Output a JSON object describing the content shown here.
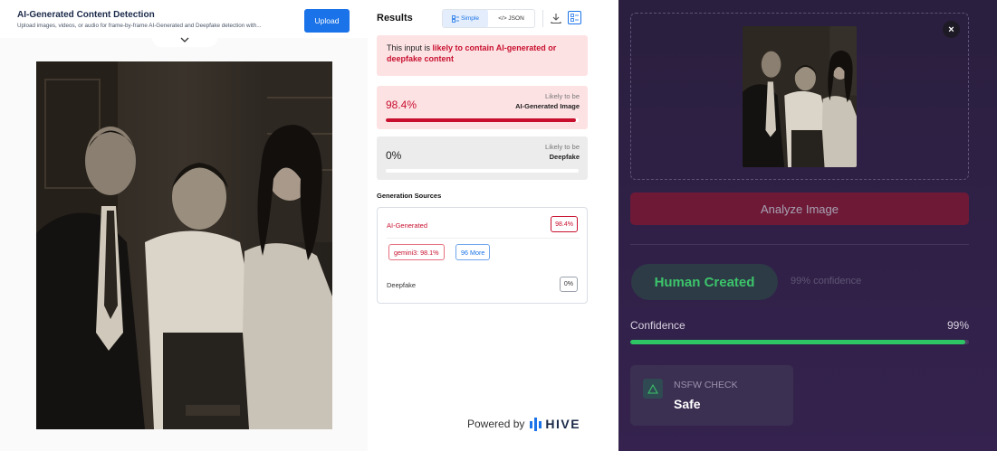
{
  "left_panel": {
    "title": "AI-Generated Content Detection",
    "subtitle": "Upload images, videos, or audio for frame-by-frame AI-Generated and Deepfake detection with...",
    "upload_label": "Upload",
    "collapse_icon": "chevron-down-icon",
    "photo_description_icon": "photo-image"
  },
  "results": {
    "title": "Results",
    "view_toggle": {
      "simple_label": "Simple",
      "json_label": "</> JSON",
      "selected": "Simple"
    },
    "icons": [
      "download-icon",
      "grid-view-icon"
    ],
    "alert": {
      "prefix": "This input is ",
      "highlight": "likely to contain AI-generated or deepfake content"
    },
    "scores": [
      {
        "percent": "98.4%",
        "label_top": "Likely to be",
        "label_bottom": "AI-Generated Image",
        "value": 0.984,
        "color": "#c8102e"
      },
      {
        "percent": "0%",
        "label_top": "Likely to be",
        "label_bottom": "Deepfake",
        "value": 0.0,
        "color": "#c8102e"
      }
    ],
    "generation_sources": {
      "title": "Generation Sources",
      "ai_label": "AI-Generated",
      "ai_value": "98.4%",
      "chips": [
        "gemini3: 98.1%",
        "96 More"
      ],
      "deepfake_label": "Deepfake",
      "deepfake_value": "0%"
    },
    "powered_by": "Powered by",
    "brand": "HIVE"
  },
  "analyzer": {
    "close_icon": "close-icon",
    "analyze_label": "Analyze Image",
    "verdict": "Human Created",
    "verdict_confidence": "99% confidence",
    "confidence_label": "Confidence",
    "confidence_value": "99%",
    "confidence_fraction": 0.99,
    "nsfw": {
      "title": "NSFW CHECK",
      "value": "Safe",
      "icon": "warning-triangle-icon"
    }
  },
  "colors": {
    "accent_blue": "#1a73e8",
    "danger_red": "#c8102e",
    "success_green": "#2ec565",
    "dark_panel": "#2f2046"
  }
}
